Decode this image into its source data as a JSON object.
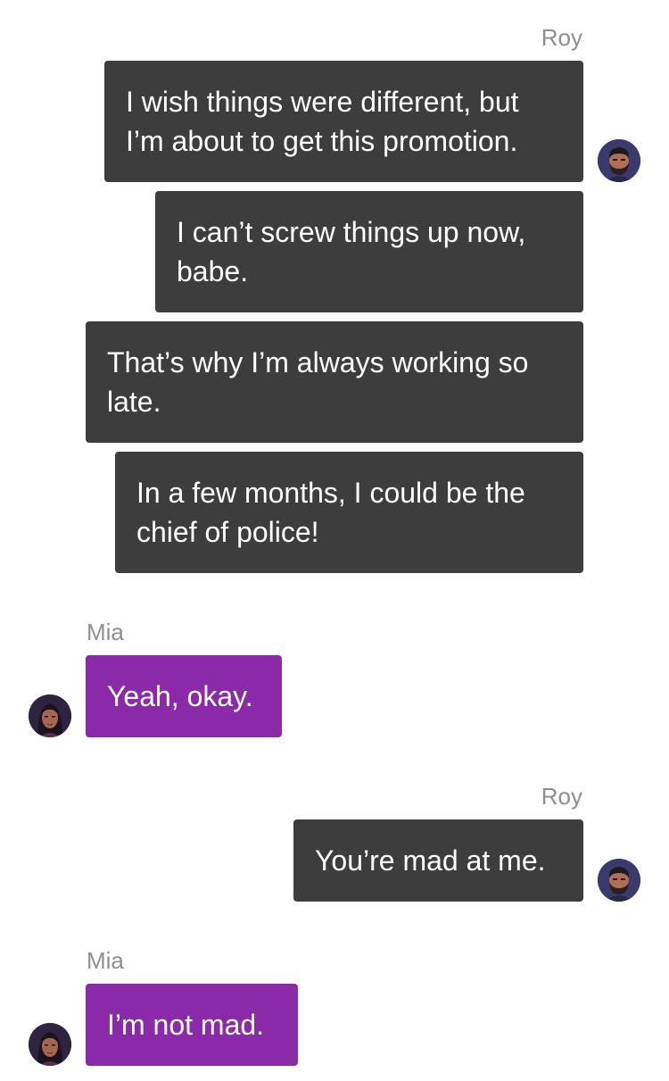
{
  "chat": {
    "groups": [
      {
        "sender": "Roy",
        "messages": [
          "I wish things were different, but\nI’m about to get this promotion.",
          "I can’t screw things up now,\nbabe.",
          "That’s why I’m always working so\nlate.",
          "In a few months, I could be the\nchief of police!"
        ]
      },
      {
        "sender": "Mia",
        "messages": [
          "Yeah, okay."
        ]
      },
      {
        "sender": "Roy",
        "messages": [
          "You’re mad at me."
        ]
      },
      {
        "sender": "Mia",
        "messages": [
          "I’m not mad."
        ]
      }
    ]
  },
  "colors": {
    "outgoing_bubble": "#3d3d3d",
    "incoming_bubble": "#8a2aa8",
    "sender_name": "#8e8e93"
  },
  "icons": {
    "roy_avatar": "bearded-man-avatar-icon",
    "mia_avatar": "woman-avatar-icon"
  }
}
